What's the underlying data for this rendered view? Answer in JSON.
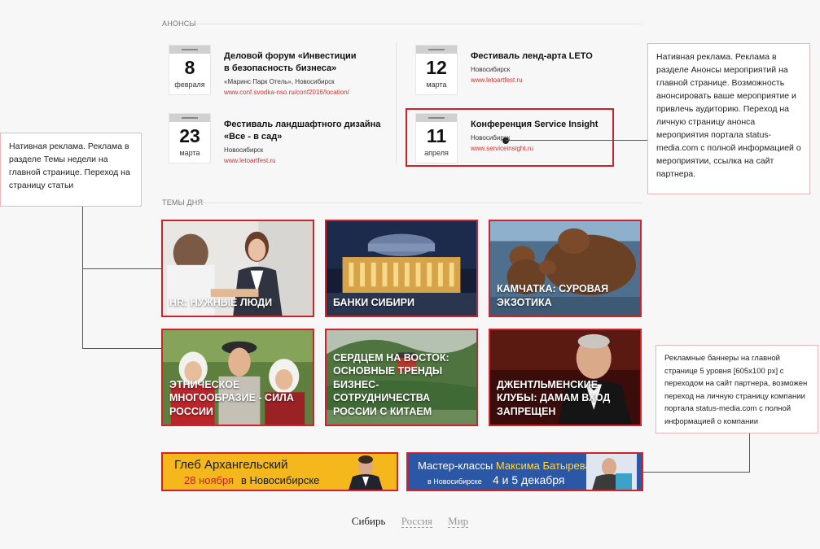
{
  "anons": {
    "heading": "АНОНСЫ",
    "events": [
      {
        "day": "8",
        "month": "февраля",
        "title_1": "Деловой форум «Инвестиции",
        "title_2": "в безопасность бизнеса»",
        "place": "«Маринс Парк Отель», Новосибирск",
        "link": "www.conf.svodka-nso.ru/conf2016/location/"
      },
      {
        "day": "12",
        "month": "марта",
        "title_1": "Фестиваль ленд-арта LETO",
        "title_2": "",
        "place": "Новосибирск",
        "link": "www.letoartfest.ru"
      },
      {
        "day": "23",
        "month": "марта",
        "title_1": "Фестиваль ландшафтного дизайна",
        "title_2": "«Все - в сад»",
        "place": "Новосибирск",
        "link": "www.letoartfest.ru"
      },
      {
        "day": "11",
        "month": "апреля",
        "title_1": "Конференция Service Insight",
        "title_2": "",
        "place": "Новосибирск",
        "link": "www.serviceinsight.ru"
      }
    ]
  },
  "notes": {
    "anons_native": "Нативная реклама. Реклама в разделе Анонсы мероприятий на главной странице. Возможность анонсировать ваше мероприятие и привлечь аудиторию. Переход на личную страницу анонса мероприятия портала status-media.com с полной информацией о мероприятии, ссылка на сайт партнера.",
    "themes_native": "Нативная реклама. Реклама в разделе Темы недели на главной странице. Переход на страницу статьи",
    "banners": "Рекламные баннеры на главной странице 5 уровня [605x100 px] с переходом на сайт партнера, возможен переход на личную страницу компании портала status-media.com с полной информацией о компании"
  },
  "themes": {
    "heading": "ТЕМЫ ДНЯ",
    "tiles": [
      {
        "caption": "HR: нужные люди"
      },
      {
        "caption": "Банки Сибири"
      },
      {
        "caption": "Камчатка: суровая экзотика"
      },
      {
        "caption": "Этническое многообразие - сила России"
      },
      {
        "caption": "Сердцем на Восток: основные тренды бизнес-сотрудничества России с Китаем"
      },
      {
        "caption": "Джентльменские клубы: дамам вход запрещен"
      }
    ]
  },
  "banners": {
    "left": {
      "name": "Глеб Архангельский",
      "date": "28 ноября",
      "city": "в Новосибирске"
    },
    "right": {
      "line_1a": "Мастер-классы",
      "line_1b": "Максима Батырева",
      "city": "в Новосибирске",
      "dates": "4 и 5 декабря"
    }
  },
  "region_tabs": [
    "Сибирь",
    "Россия",
    "Мир"
  ],
  "colors": {
    "accent": "#d0222b",
    "link": "#d2332e",
    "banner_yellow": "#f4b81c",
    "banner_blue": "#2a57a6"
  }
}
